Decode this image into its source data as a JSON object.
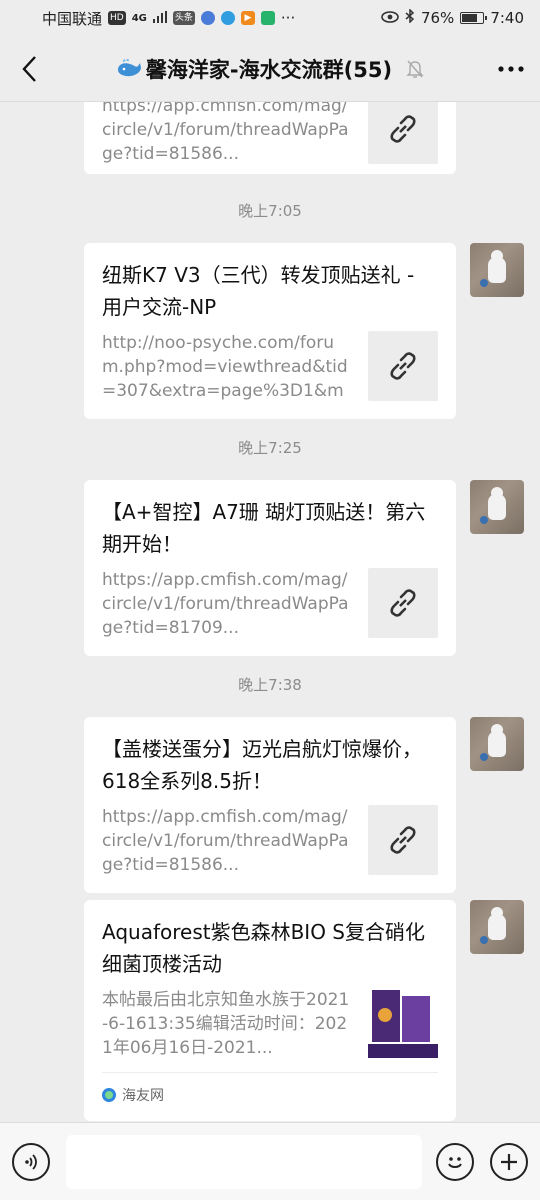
{
  "status_bar": {
    "carrier": "中国联通",
    "hd": "HD",
    "network": "4G",
    "mini_badge": "头条",
    "overflow": "···",
    "battery_percent": "76%",
    "battery_level": 0.76,
    "time": "7:40"
  },
  "title_bar": {
    "title": "馨海洋家-海水交流群(55)"
  },
  "messages": [
    {
      "title": "",
      "desc": "https://app.cmfish.com/mag/circle/v1/forum/threadWapPage?tid=81586..."
    },
    {
      "time": "晚上7:05",
      "title": "纽斯K7 V3（三代）转发顶贴送礼 - 用户交流-NP",
      "desc": "http://noo-psyche.com/forum.php?mod=viewthread&tid=307&extra=page%3D1&mo..."
    },
    {
      "time": "晚上7:25",
      "title": "【A+智控】A7珊 瑚灯顶贴送！第六期开始！",
      "desc": "https://app.cmfish.com/mag/circle/v1/forum/threadWapPage?tid=81709..."
    },
    {
      "time": "晚上7:38",
      "title": "【盖楼送蛋分】迈光启航灯惊爆价，618全系列8.5折！",
      "desc": "https://app.cmfish.com/mag/circle/v1/forum/threadWapPage?tid=81586..."
    },
    {
      "title": "Aquaforest紫色森林BIO S复合硝化细菌顶楼活动",
      "desc": "本帖最后由北京知鱼水族于2021-6-1613:35编辑活动时间：2021年06月16日-2021...",
      "source": "海友网"
    }
  ],
  "colors": {
    "background": "#ededed",
    "card": "#ffffff",
    "muted_text": "#8a8a8a"
  }
}
